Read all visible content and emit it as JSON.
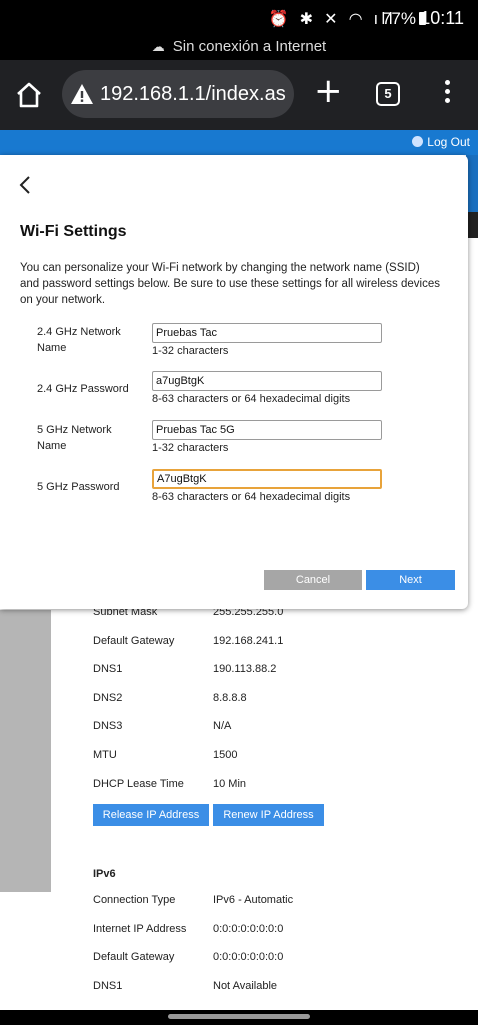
{
  "status_bar": {
    "icons": "⏰ ✱ ✕ ◠ ıll",
    "battery": "77%",
    "time": "10:11"
  },
  "offline_banner": {
    "text": "Sin conexión a Internet"
  },
  "browser": {
    "url": "192.168.1.1/index.as",
    "tab_count": "5"
  },
  "header": {
    "logout": "Log Out"
  },
  "modal": {
    "title": "Wi-Fi Settings",
    "description": "You can personalize your Wi-Fi network by changing the network name (SSID) and password settings below. Be sure to use these settings for all wireless devices on your network.",
    "fields": [
      {
        "label": "2.4 GHz Network Name",
        "value": "Pruebas Tac",
        "hint": "1-32 characters"
      },
      {
        "label": "2.4 GHz Password",
        "value": "a7ugBtgK",
        "hint": "8-63 characters or 64 hexadecimal digits"
      },
      {
        "label": "5 GHz Network Name",
        "value": "Pruebas Tac 5G",
        "hint": "1-32 characters"
      },
      {
        "label": "5 GHz Password",
        "value": "A7ugBtgK",
        "hint": "8-63 characters or 64 hexadecimal digits"
      }
    ],
    "cancel": "Cancel",
    "next": "Next"
  },
  "ipv4": {
    "rows": [
      {
        "key": "Subnet Mask",
        "value": "255.255.255.0"
      },
      {
        "key": "Default Gateway",
        "value": "192.168.241.1"
      },
      {
        "key": "DNS1",
        "value": "190.113.88.2"
      },
      {
        "key": "DNS2",
        "value": "8.8.8.8"
      },
      {
        "key": "DNS3",
        "value": "N/A"
      },
      {
        "key": "MTU",
        "value": "1500"
      },
      {
        "key": "DHCP Lease Time",
        "value": "10 Min"
      }
    ],
    "release_button": "Release IP Address",
    "renew_button": "Renew IP Address"
  },
  "ipv6": {
    "title": "IPv6",
    "rows": [
      {
        "key": "Connection Type",
        "value": "IPv6 - Automatic"
      },
      {
        "key": "Internet IP Address",
        "value": "0:0:0:0:0:0:0:0"
      },
      {
        "key": "Default Gateway",
        "value": "0:0:0:0:0:0:0:0"
      },
      {
        "key": "DNS1",
        "value": "Not Available"
      }
    ]
  }
}
